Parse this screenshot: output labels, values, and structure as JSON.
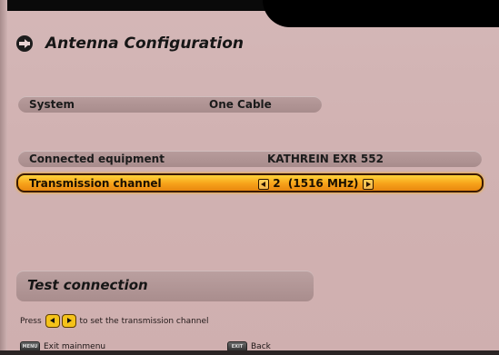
{
  "title": "Antenna Configuration",
  "rows": {
    "system": {
      "label": "System",
      "value": "One Cable"
    },
    "connected": {
      "label": "Connected equipment",
      "value": "KATHREIN EXR 552"
    },
    "transmission": {
      "label": "Transmission channel",
      "value": "2  (1516 MHz)"
    }
  },
  "test_button": "Test connection",
  "hint": {
    "prefix": "Press",
    "suffix": "to set the transmission channel"
  },
  "footer": {
    "menu_key": "MENU",
    "menu_label": "Exit mainmenu",
    "exit_key": "EXIT",
    "exit_label": "Back"
  },
  "colors": {
    "selected": "#f7a21a",
    "background": "#d1b2b2",
    "row": "#a88c8c"
  }
}
